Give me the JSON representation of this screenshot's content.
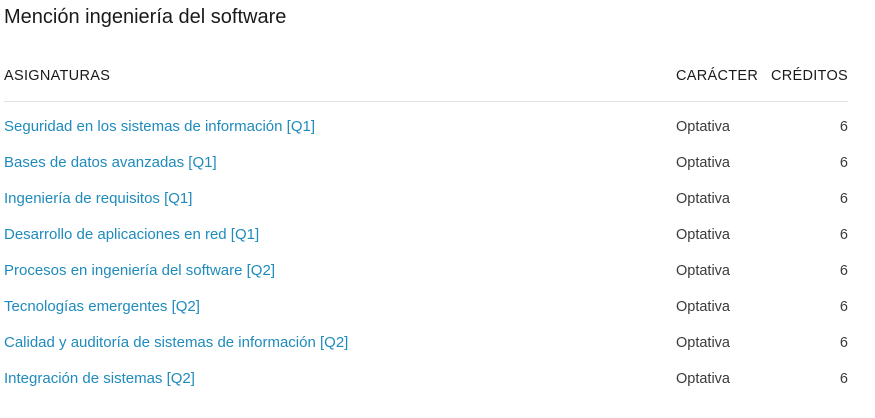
{
  "page": {
    "title": "Mención ingeniería del software"
  },
  "table": {
    "headers": {
      "subject": "ASIGNATURAS",
      "type": "CARÁCTER",
      "credits": "CRÉDITOS"
    },
    "rows": [
      {
        "subject": "Seguridad en los sistemas de información [Q1]",
        "type": "Optativa",
        "credits": "6"
      },
      {
        "subject": "Bases de datos avanzadas [Q1]",
        "type": "Optativa",
        "credits": "6"
      },
      {
        "subject": "Ingeniería de requisitos [Q1]",
        "type": "Optativa",
        "credits": "6"
      },
      {
        "subject": "Desarrollo de aplicaciones en red [Q1]",
        "type": "Optativa",
        "credits": "6"
      },
      {
        "subject": "Procesos en ingeniería del software [Q2]",
        "type": "Optativa",
        "credits": "6"
      },
      {
        "subject": "Tecnologías emergentes [Q2]",
        "type": "Optativa",
        "credits": "6"
      },
      {
        "subject": "Calidad y auditoría de sistemas de información [Q2]",
        "type": "Optativa",
        "credits": "6"
      },
      {
        "subject": "Integración de sistemas [Q2]",
        "type": "Optativa",
        "credits": "6"
      }
    ]
  },
  "colors": {
    "link": "#1f8bbd",
    "text": "#1a1a1a",
    "divider": "#e3e3e3"
  }
}
